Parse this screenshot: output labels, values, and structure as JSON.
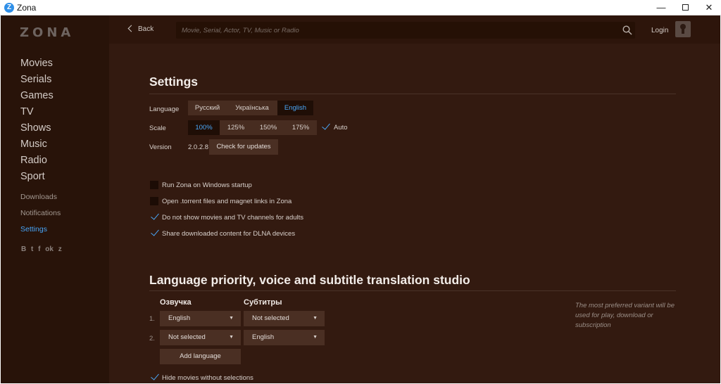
{
  "window": {
    "title": "Zona",
    "app_icon_letter": "Z"
  },
  "sidebar": {
    "logo": "ZONA",
    "main_items": [
      {
        "label": "Movies"
      },
      {
        "label": "Serials"
      },
      {
        "label": "Games"
      },
      {
        "label": "TV"
      },
      {
        "label": "Shows"
      },
      {
        "label": "Music"
      },
      {
        "label": "Radio"
      },
      {
        "label": "Sport"
      }
    ],
    "sub_items": [
      {
        "label": "Downloads"
      },
      {
        "label": "Notifications"
      },
      {
        "label": "Settings",
        "active": true
      }
    ],
    "socials": [
      "B",
      "t",
      "f",
      "ok",
      "z"
    ]
  },
  "header": {
    "back_label": "Back",
    "search_placeholder": "Movie, Serial, Actor, TV, Music or Radio",
    "login_label": "Login"
  },
  "settings": {
    "title": "Settings",
    "language_label": "Language",
    "languages": [
      {
        "label": "Русский"
      },
      {
        "label": "Українська"
      },
      {
        "label": "English",
        "selected": true
      }
    ],
    "scale_label": "Scale",
    "scales": [
      {
        "label": "100%",
        "selected": true
      },
      {
        "label": "125%"
      },
      {
        "label": "150%"
      },
      {
        "label": "175%"
      }
    ],
    "auto_label": "Auto",
    "auto_checked": true,
    "version_label": "Version",
    "version_value": "2.0.2.8",
    "check_updates_label": "Check for updates",
    "options": [
      {
        "label": "Run Zona on Windows startup",
        "checked": false
      },
      {
        "label": "Open .torrent files and magnet links in Zona",
        "checked": false
      },
      {
        "label": "Do not show movies and TV channels for adults",
        "checked": true
      },
      {
        "label": "Share downloaded content for DLNA devices",
        "checked": true
      }
    ]
  },
  "priority": {
    "title": "Language priority, voice and subtitle translation studio",
    "voice_header": "Озвучка",
    "subs_header": "Субтитры",
    "rows": [
      {
        "num": "1.",
        "voice": "English",
        "subs": "Not selected"
      },
      {
        "num": "2.",
        "voice": "Not selected",
        "subs": "English"
      }
    ],
    "add_language_label": "Add language",
    "hint": "The most preferred variant will be used for play, download or subscription",
    "hide_label": "Hide movies without selections",
    "hide_checked": true
  },
  "colors": {
    "accent": "#4aa6f6",
    "background": "#331a10",
    "sidebar": "#281309"
  }
}
